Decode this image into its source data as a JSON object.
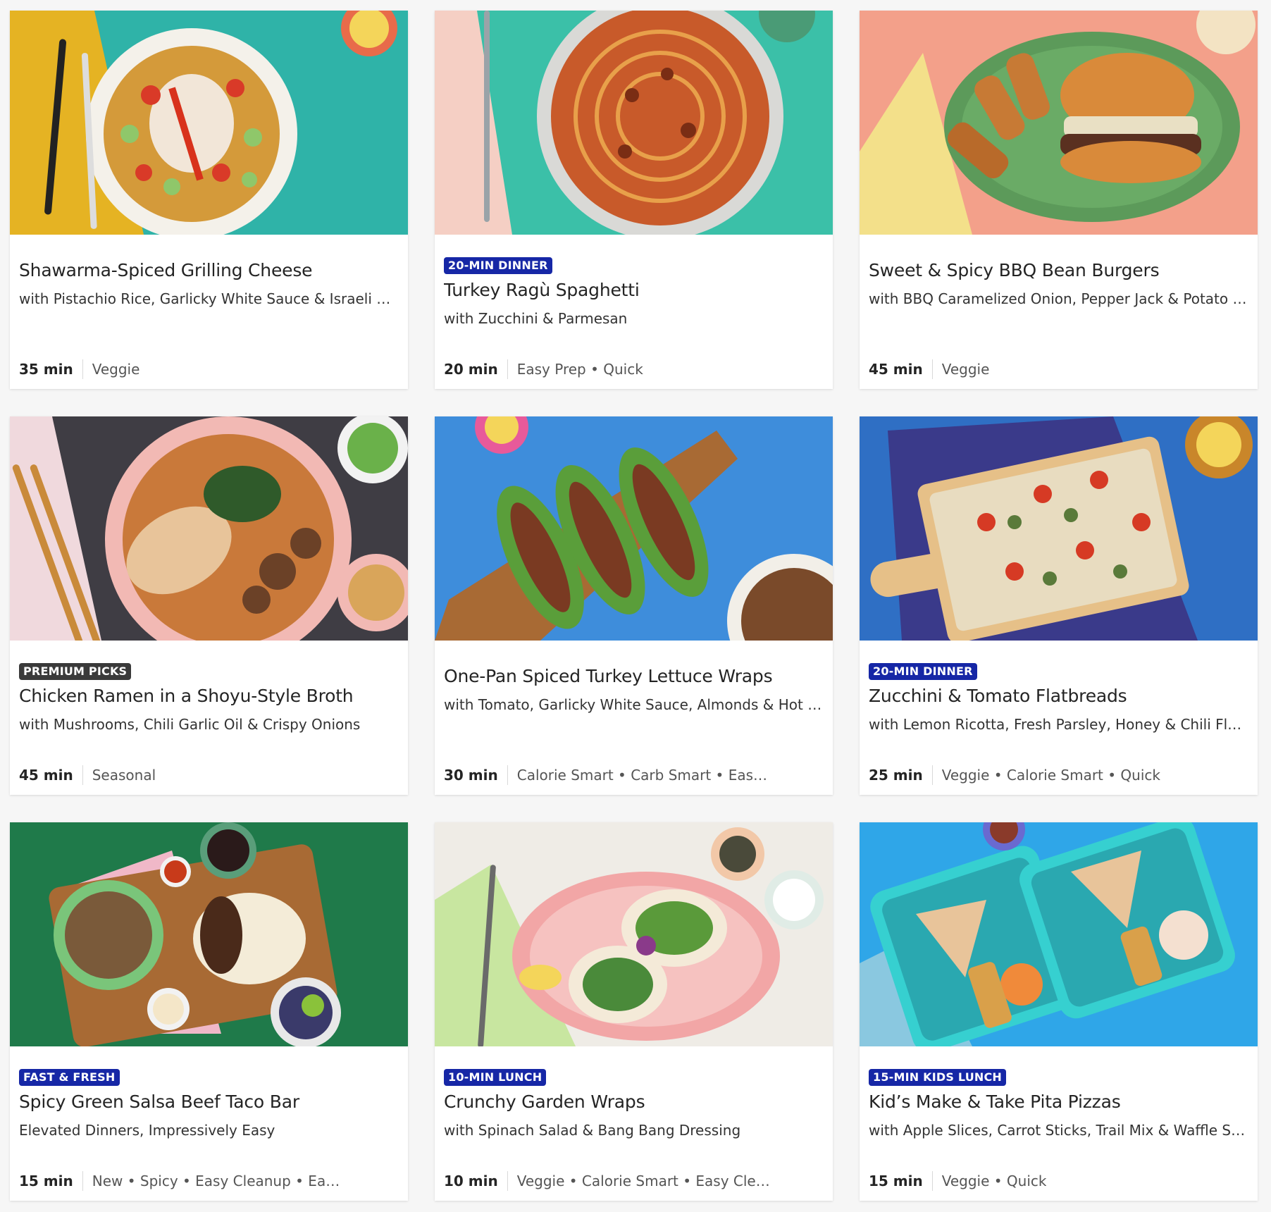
{
  "cards": [
    {
      "badge": "",
      "title": "Shawarma-Spiced Grilling Cheese",
      "subtitle": "with Pistachio Rice, Garlicky White Sauce & Israeli Salad",
      "time": "35 min",
      "tags": "Veggie",
      "image_icon": "rice-bowl-photo"
    },
    {
      "badge": "20-MIN DINNER",
      "title": "Turkey Ragù Spaghetti",
      "subtitle": "with Zucchini & Parmesan",
      "time": "20 min",
      "tags": "Easy Prep • Quick",
      "image_icon": "spaghetti-photo"
    },
    {
      "badge": "",
      "title": "Sweet & Spicy BBQ Bean Burgers",
      "subtitle": "with BBQ Caramelized Onion, Pepper Jack & Potato We…",
      "time": "45 min",
      "tags": "Veggie",
      "image_icon": "burger-photo"
    },
    {
      "badge": "PREMIUM PICKS",
      "title": "Chicken Ramen in a Shoyu-Style Broth",
      "subtitle": "with Mushrooms, Chili Garlic Oil & Crispy Onions",
      "time": "45 min",
      "tags": "Seasonal",
      "image_icon": "ramen-photo"
    },
    {
      "badge": "",
      "title": "One-Pan Spiced Turkey Lettuce Wraps",
      "subtitle": "with Tomato, Garlicky White Sauce, Almonds & Hot Sauce",
      "time": "30 min",
      "tags": "Calorie Smart • Carb Smart • Easy C…",
      "image_icon": "lettuce-wraps-photo"
    },
    {
      "badge": "20-MIN DINNER",
      "title": "Zucchini & Tomato Flatbreads",
      "subtitle": "with Lemon Ricotta, Fresh Parsley, Honey & Chili Flakes",
      "time": "25 min",
      "tags": "Veggie • Calorie Smart • Quick",
      "image_icon": "flatbread-photo"
    },
    {
      "badge": "FAST & FRESH",
      "title": "Spicy Green Salsa Beef Taco Bar",
      "subtitle": "Elevated Dinners, Impressively Easy",
      "time": "15 min",
      "tags": "New • Spicy • Easy Cleanup • Easy P…",
      "image_icon": "taco-bar-photo"
    },
    {
      "badge": "10-MIN LUNCH",
      "title": "Crunchy Garden Wraps",
      "subtitle": "with Spinach Salad & Bang Bang Dressing",
      "time": "10 min",
      "tags": "Veggie • Calorie Smart • Easy Clean…",
      "image_icon": "garden-wraps-photo"
    },
    {
      "badge": "15-MIN KIDS LUNCH",
      "title": "Kid’s Make & Take Pita Pizzas",
      "subtitle": "with Apple Slices, Carrot Sticks, Trail Mix & Waffle Strips",
      "time": "15 min",
      "tags": "Veggie • Quick",
      "image_icon": "pita-pizza-lunchbox-photo"
    }
  ],
  "colors": {
    "badge_blue": "#1627a6",
    "badge_gray": "#3a3a3a",
    "page_bg": "#f6f6f6"
  }
}
